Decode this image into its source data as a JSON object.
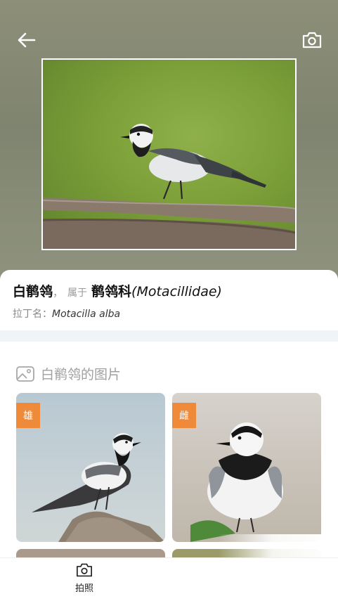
{
  "header": {
    "back_icon": "arrow-left-icon",
    "camera_icon": "camera-icon"
  },
  "species": {
    "name": "白鹡鸰",
    "comma": "，",
    "belongs_label": "属于",
    "family": "鹡鸰科",
    "family_latin": "(Motacillidae)",
    "latin_label": "拉丁名：",
    "latin_name": "Motacilla alba"
  },
  "gallery": {
    "icon": "image-icon",
    "title": "白鹡鸰的图片",
    "items": [
      {
        "badge": "雄"
      },
      {
        "badge": "雌"
      },
      {
        "badge": ""
      },
      {
        "badge": ""
      }
    ]
  },
  "bottom_bar": {
    "icon": "camera-icon",
    "label": "拍照"
  },
  "colors": {
    "badge": "#ef8a3a",
    "divider_band": "#eef4f8",
    "muted_text": "#a0a0a0"
  }
}
